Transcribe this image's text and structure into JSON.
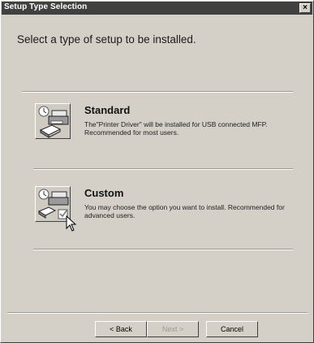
{
  "window": {
    "title": "Setup Type Selection",
    "close_label": "×"
  },
  "heading": "Select a type of setup to be installed.",
  "options": [
    {
      "title": "Standard",
      "description": "The\"Printer Driver\" will be installed for USB connected MFP. Recommended for most users.",
      "icon": "printer-setup-icon"
    },
    {
      "title": "Custom",
      "description": "You may choose the option you want to install. Recommended for advanced users.",
      "icon": "printer-custom-setup-icon"
    }
  ],
  "buttons": {
    "back": "< Back",
    "next": "Next >",
    "cancel": "Cancel"
  },
  "colors": {
    "dialog_bg": "#d4d0c8",
    "titlebar_bg": "#404040",
    "titlebar_text": "#ffffff"
  }
}
